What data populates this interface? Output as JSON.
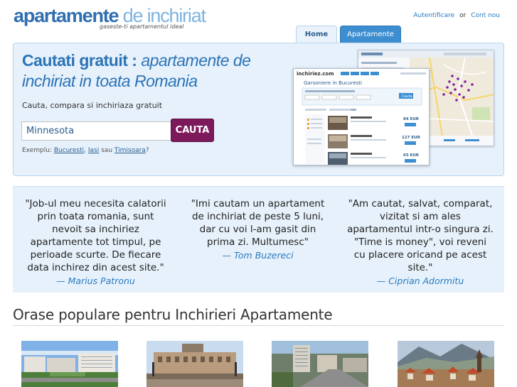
{
  "header": {
    "logo_word1": "apartamente",
    "logo_word2": " de inchiriat",
    "tagline": "gaseste-ti apartamentul ideal",
    "login_link": "Autentificare",
    "or_text": "or",
    "account_link": "Cont nou"
  },
  "tabs": [
    {
      "label": "Home",
      "active": true
    },
    {
      "label": "Apartamente",
      "active": false
    }
  ],
  "hero": {
    "title_bold": "Cautati gratuit :",
    "title_italic": " apartamente de inchiriat in toata Romania",
    "subtitle": "Cauta, compara si inchiriaza gratuit",
    "search_value": "Minnesota",
    "search_button": "CAUTA",
    "example_prefix": "Exemplu: ",
    "example_city1": "Bucuresti",
    "example_city2": "Iasi",
    "example_sep": ", ",
    "example_or": " sau ",
    "example_city3": "Timisoara",
    "example_suffix": "?"
  },
  "preview": {
    "site_name": "inchiriez.com",
    "heading": "Garsoniere in Bucuresti",
    "button": "Cauta",
    "prices": [
      "84 EUR",
      "127 EUR",
      "65 EUR"
    ]
  },
  "testimonials": [
    {
      "quote": "\"Job-ul meu necesita calatorii prin toata romania, sunt nevoit sa inchiriez apartamente tot timpul, pe perioade scurte. De fiecare data inchirez din acest site.\"",
      "author": "— Marius Patronu"
    },
    {
      "quote": "\"Imi cautam un apartament de inchiriat de peste 5 luni, dar cu voi l-am gasit din prima zi. Multumesc\"",
      "author": "— Tom Buzereci"
    },
    {
      "quote": "\"Am cautat, salvat, comparat, vizitat si am ales apartamentul intr-o singura zi. \"Time is money\", voi reveni cu placere oricand pe acest site.\"",
      "author": "— Ciprian Adormitu"
    }
  ],
  "popular": {
    "title": "Orase populare pentru Inchirieri Apartamente"
  },
  "colors": {
    "brand_blue": "#2f6fb0",
    "light_blue": "#7fb3e0",
    "panel_bg": "#e6f1fb",
    "search_button": "#7d1a5c",
    "link": "#2a7bc1"
  }
}
